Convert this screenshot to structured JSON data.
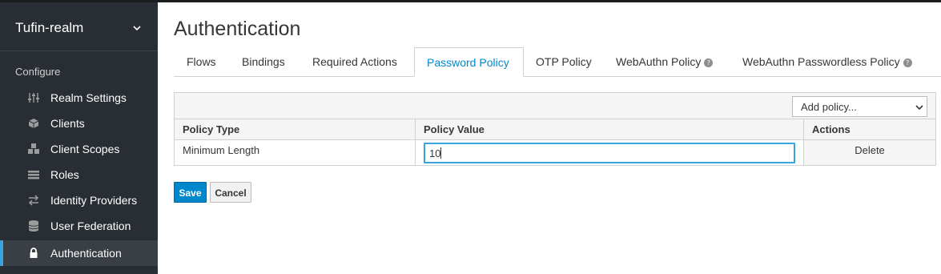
{
  "sidebar": {
    "realm_name": "Tufin-realm",
    "section_label": "Configure",
    "items": [
      {
        "label": "Realm Settings",
        "icon": "sliders-icon"
      },
      {
        "label": "Clients",
        "icon": "cube-icon"
      },
      {
        "label": "Client Scopes",
        "icon": "cubes-icon"
      },
      {
        "label": "Roles",
        "icon": "list-icon"
      },
      {
        "label": "Identity Providers",
        "icon": "exchange-icon"
      },
      {
        "label": "User Federation",
        "icon": "database-icon"
      },
      {
        "label": "Authentication",
        "icon": "lock-icon",
        "active": true
      }
    ]
  },
  "main": {
    "title": "Authentication",
    "tabs": [
      {
        "label": "Flows"
      },
      {
        "label": "Bindings"
      },
      {
        "label": "Required Actions"
      },
      {
        "label": "Password Policy",
        "active": true
      },
      {
        "label": "OTP Policy"
      },
      {
        "label": "WebAuthn Policy",
        "help": true
      },
      {
        "label": "WebAuthn Passwordless Policy",
        "help": true
      }
    ],
    "add_policy_label": "Add policy...",
    "table": {
      "headers": [
        "Policy Type",
        "Policy Value",
        "Actions"
      ],
      "rows": [
        {
          "type": "Minimum Length",
          "value": "10",
          "action": "Delete"
        }
      ]
    },
    "save_label": "Save",
    "cancel_label": "Cancel"
  },
  "colors": {
    "sidebar_bg": "#292e34",
    "active_accent": "#39a5dc",
    "primary_button": "#0088ce",
    "tab_active_text": "#0088ce"
  }
}
